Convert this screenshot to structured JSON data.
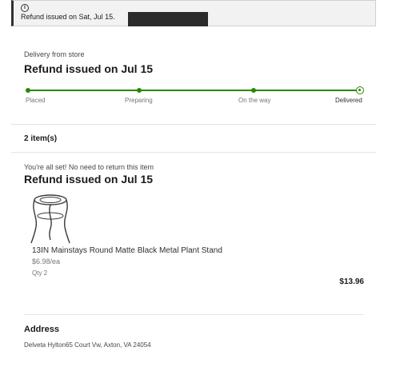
{
  "alert": {
    "icon": "info-icon",
    "text": "Refund issued on Sat, Jul 15."
  },
  "delivery": {
    "section_label": "Delivery from store",
    "status_heading": "Refund issued on Jul 15"
  },
  "progress": {
    "steps": [
      {
        "label": "Placed",
        "completed": true
      },
      {
        "label": "Preparing",
        "completed": true
      },
      {
        "label": "On the way",
        "completed": true
      },
      {
        "label": "Delivered",
        "completed": true,
        "current": true
      }
    ],
    "accent_color": "#2a8703"
  },
  "items": {
    "count_label": "2 item(s)",
    "return_note": "You're all set! No need to return this item",
    "status_heading": "Refund issued on Jul 15",
    "products": [
      {
        "image_icon": "plant-stand-image",
        "name": "13IN Mainstays Round Matte Black Metal Plant Stand",
        "unit_price": "$6.98/ea",
        "quantity": "Qty 2",
        "total": "$13.96"
      }
    ]
  },
  "address": {
    "title": "Address",
    "line": "Delveta Hylton65 Court Vw, Axton, VA 24054"
  }
}
